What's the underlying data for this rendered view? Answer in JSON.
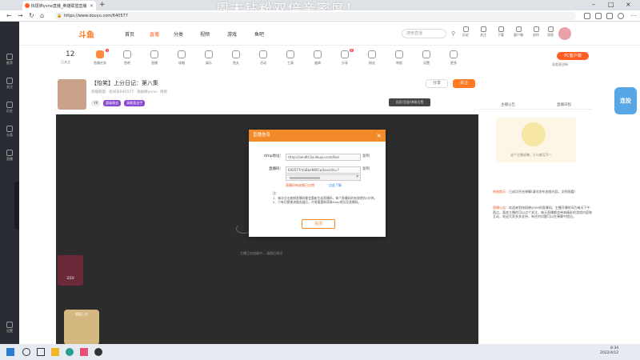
{
  "browser": {
    "tab_title": "快斑婷yvne直播_英雄联盟直播",
    "tab_close": "×",
    "new_tab": "+",
    "overlay_title": "周末钻粉双倍亲密度！",
    "url": "https://www.douyu.com/640577",
    "window_controls": [
      "–",
      "□",
      "×"
    ]
  },
  "site": {
    "logo": "斗鱼",
    "nav": [
      "首页",
      "直播",
      "分类",
      "视频",
      "游戏",
      "鱼吧"
    ],
    "search_placeholder": "搜索直播",
    "header_icons": [
      "历史",
      "关注",
      "下载",
      "客户端",
      "创作",
      "消息"
    ]
  },
  "category_bar": {
    "count": "12",
    "count_label": "已关注",
    "items": [
      "鱼塘任务",
      "鱼吧",
      "直播",
      "攻略",
      "娱乐",
      "鱼丸",
      "活动",
      "工具",
      "盛典",
      "分享",
      "粉丝",
      "举报",
      "设置",
      "更多"
    ],
    "pc_client": "PC客户端",
    "pc_client_sub": "观看更流畅"
  },
  "left_sidebar": [
    "推荐",
    "关注",
    "历史",
    "分类",
    "直播",
    "设置"
  ],
  "room": {
    "title": "【怡笑】上分日记：第八集",
    "meta": "英雄联盟  ·  房间号640577  ·  快斑婷yvne  ·  周榜",
    "tags": [
      "V8",
      "超级粉丝",
      "高能狙击手"
    ],
    "share": "分享",
    "follow": "关注",
    "report": "画质/音量/弹幕设置"
  },
  "video": {
    "hint": "主播正在加载中... 请稍后再试"
  },
  "modal": {
    "title": "直播信息",
    "close": "×",
    "rtmp_label": "rtmp地址：",
    "rtmp_value": "rtmp://sendtc3a.douyu.com/live",
    "key_label": "直播码：",
    "key_value": "640577rVuBaeN0tCw3avcets=?",
    "copy": "复制",
    "link_warning": "直播码有效期已过期",
    "link_more": "点此了解",
    "notes": [
      "注：",
      "1、每次点击复制直播码都会重新生成直播码，每个直播码的有效期为5分钟。",
      "2、只有切换推流服务器后，才需要重新获取rtmp地址及直播码。"
    ],
    "button": "关闭"
  },
  "right_panel": {
    "tabs": [
      "主播公告",
      "直播日程"
    ],
    "art_caption": "这个主播很懒，什么都没写~",
    "messages": [
      {
        "tag": "系统提示：",
        "text": "已成功开启弹幕(请勿发布违规内容，文明观看)"
      },
      {
        "tag": "直播公告：",
        "text": "欢迎来到快斑婷yvne的直播间，主播开播时间为每天下午两点，喜欢主播的可以点个关注，每天直播都会带来精彩的游戏内容和互动，欢迎大家多多支持，有任何问题可以在弹幕中提出。"
      }
    ],
    "float_badge": "连投"
  },
  "gifts": {
    "gift1_label": "2/10",
    "gift2_label": "超值上车"
  },
  "taskbar": {
    "time": "8:34",
    "date": "2022/4/12"
  },
  "colors": {
    "accent": "#ff5d23",
    "modal_header": "#f28a2a",
    "video_bg": "#2c2c2c",
    "sidebar": "#2a2c33"
  }
}
